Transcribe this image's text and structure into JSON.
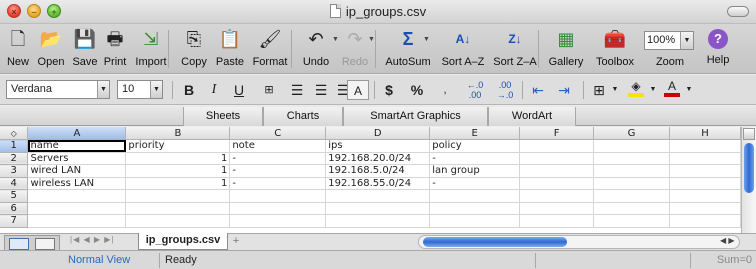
{
  "window": {
    "title": "ip_groups.csv"
  },
  "toolbar": {
    "buttons": [
      {
        "label": "New",
        "icon": "new-icon",
        "glyph": "🗋",
        "enabled": true
      },
      {
        "label": "Open",
        "icon": "open-icon",
        "glyph": "📂",
        "enabled": true
      },
      {
        "label": "Save",
        "icon": "save-icon",
        "glyph": "💾",
        "enabled": true
      },
      {
        "label": "Print",
        "icon": "print-icon",
        "glyph": "🖶",
        "enabled": true
      },
      {
        "label": "Import",
        "icon": "import-icon",
        "glyph": "⇲",
        "enabled": true
      },
      {
        "label": "Copy",
        "icon": "copy-icon",
        "glyph": "⎘",
        "enabled": true
      },
      {
        "label": "Paste",
        "icon": "paste-icon",
        "glyph": "📋",
        "enabled": true
      },
      {
        "label": "Format",
        "icon": "format-brush-icon",
        "glyph": "🖌",
        "enabled": true
      },
      {
        "label": "Undo",
        "icon": "undo-icon",
        "glyph": "↶",
        "enabled": true
      },
      {
        "label": "Redo",
        "icon": "redo-icon",
        "glyph": "↷",
        "enabled": false
      },
      {
        "label": "AutoSum",
        "icon": "autosum-icon",
        "glyph": "Σ",
        "enabled": true
      },
      {
        "label": "Sort A–Z",
        "icon": "sort-az-icon",
        "glyph": "A↓",
        "enabled": true
      },
      {
        "label": "Sort Z–A",
        "icon": "sort-za-icon",
        "glyph": "Z↓",
        "enabled": true
      },
      {
        "label": "Gallery",
        "icon": "gallery-icon",
        "glyph": "▦",
        "enabled": true
      },
      {
        "label": "Toolbox",
        "icon": "toolbox-icon",
        "glyph": "🧰",
        "enabled": true
      },
      {
        "label": "Zoom",
        "icon": "zoom-icon",
        "glyph": "",
        "enabled": true
      },
      {
        "label": "Help",
        "icon": "help-icon",
        "glyph": "?",
        "enabled": true
      }
    ],
    "zoom_value": "100%"
  },
  "format": {
    "font_name": "Verdana",
    "font_size": "10",
    "bold_glyph": "B",
    "italic_glyph": "I",
    "underline_glyph": "U",
    "currency_glyph": "$",
    "percent_glyph": "%",
    "colors": {
      "fill": "#f5e400",
      "font": "#d00000"
    }
  },
  "ribbon": {
    "tabs": [
      "Sheets",
      "Charts",
      "SmartArt Graphics",
      "WordArt"
    ]
  },
  "sheet": {
    "corner_glyph": "◇",
    "columns": [
      "A",
      "B",
      "C",
      "D",
      "E",
      "F",
      "G",
      "H"
    ],
    "row_numbers": [
      "1",
      "2",
      "3",
      "4",
      "5",
      "6",
      "7"
    ],
    "rows": [
      [
        "name",
        "priority",
        "note",
        "ips",
        "policy",
        "",
        "",
        ""
      ],
      [
        "Servers",
        "1",
        "-",
        "192.168.20.0/24",
        "-",
        "",
        "",
        ""
      ],
      [
        "wired LAN",
        "1",
        "-",
        "192.168.5.0/24",
        "lan group",
        "",
        "",
        ""
      ],
      [
        "wireless LAN",
        "1",
        "-",
        "192.168.55.0/24",
        "-",
        "",
        "",
        ""
      ],
      [
        "",
        "",
        "",
        "",
        "",
        "",
        "",
        ""
      ],
      [
        "",
        "",
        "",
        "",
        "",
        "",
        "",
        ""
      ],
      [
        "",
        "",
        "",
        "",
        "",
        "",
        "",
        ""
      ]
    ],
    "active_cell": "A1",
    "tab_name": "ip_groups.csv"
  },
  "status": {
    "view": "Normal View",
    "state": "Ready",
    "sum": "Sum=0"
  }
}
